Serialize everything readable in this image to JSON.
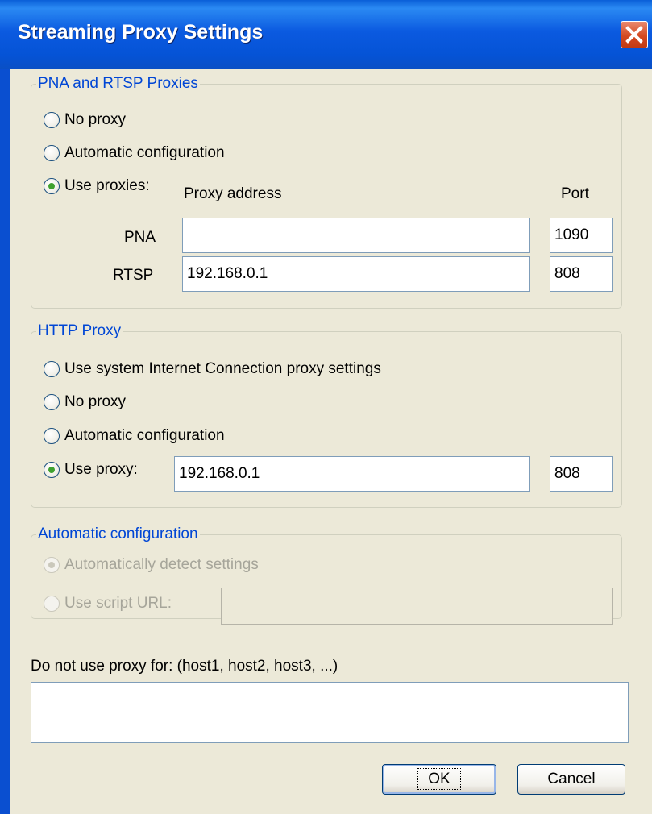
{
  "window": {
    "title": "Streaming Proxy Settings"
  },
  "pna_rtsp": {
    "legend": "PNA and RTSP Proxies",
    "options": {
      "no_proxy": "No proxy",
      "auto_config": "Automatic configuration",
      "use_proxies": "Use proxies:"
    },
    "selected": "use_proxies",
    "col_address": "Proxy address",
    "col_port": "Port",
    "pna": {
      "label": "PNA",
      "address": "",
      "port": "1090"
    },
    "rtsp": {
      "label": "RTSP",
      "address": "192.168.0.1",
      "port": "808"
    }
  },
  "http": {
    "legend": "HTTP Proxy",
    "options": {
      "system": "Use system Internet Connection proxy settings",
      "no_proxy": "No proxy",
      "auto_config": "Automatic configuration",
      "use_proxy": "Use proxy:"
    },
    "selected": "use_proxy",
    "address": "192.168.0.1",
    "port": "808"
  },
  "auto_config": {
    "legend": "Automatic configuration",
    "detect": "Automatically detect settings",
    "script_url": "Use script URL:",
    "script_value": "",
    "enabled": false
  },
  "bypass": {
    "label": "Do not use proxy for: (host1, host2, host3, ...)",
    "value": ""
  },
  "buttons": {
    "ok": "OK",
    "cancel": "Cancel"
  },
  "colors": {
    "title_bar": "#0553d6",
    "accent": "#0046d5",
    "radio_dot": "#3fa12f"
  }
}
